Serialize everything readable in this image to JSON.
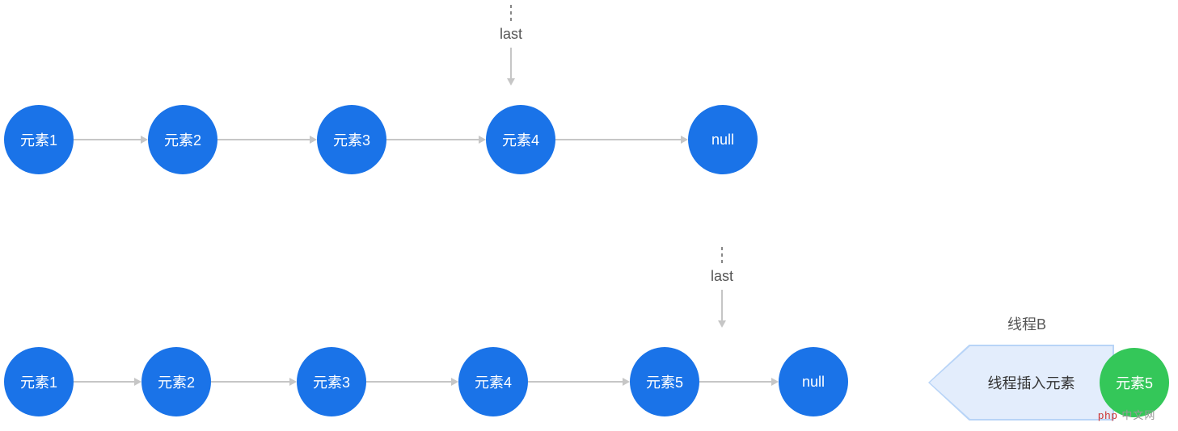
{
  "row1": {
    "nodes": [
      "元素1",
      "元素2",
      "元素3",
      "元素4",
      "null"
    ],
    "pointer_label": "last",
    "pointer_target_index": 3
  },
  "row2": {
    "nodes": [
      "元素1",
      "元素2",
      "元素3",
      "元素4",
      "元素5",
      "null"
    ],
    "pointer_label": "last",
    "pointer_target_index": 4
  },
  "thread_b": {
    "label": "线程B",
    "action_text": "线程插入元素",
    "insert_node": "元素5"
  },
  "watermark": {
    "php": "php",
    "cn": "中文网"
  }
}
